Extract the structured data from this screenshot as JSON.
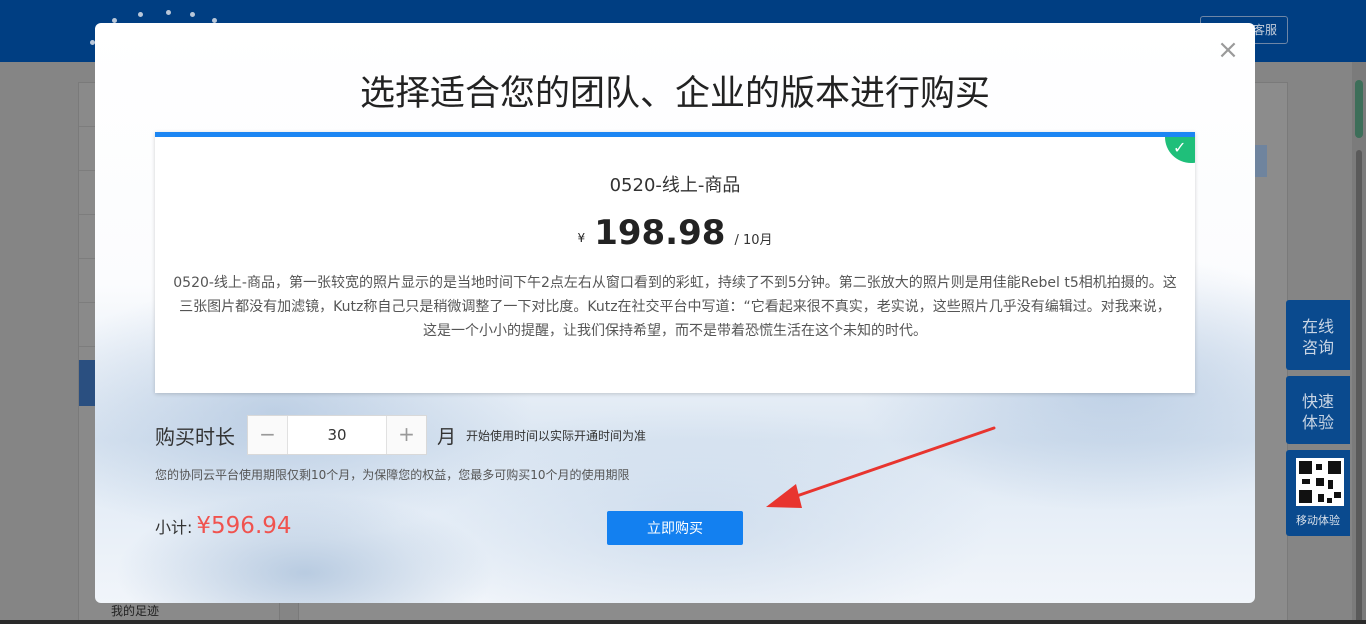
{
  "background": {
    "online_service_label": "客服",
    "sidebar_footprint": "我的足迹"
  },
  "float_buttons": {
    "consult": "在线\n咨询",
    "consult_line1": "在线",
    "consult_line2": "咨询",
    "trial_line1": "快速",
    "trial_line2": "体验",
    "mobile_label": "移动体验"
  },
  "modal": {
    "title": "选择适合您的团队、企业的版本进行购买",
    "close_icon": "close-icon",
    "plan": {
      "name": "0520-线上-商品",
      "currency": "¥",
      "price": "198.98",
      "period": "/ 10月",
      "description": "0520-线上-商品，第一张较宽的照片显示的是当地时间下午2点左右从窗口看到的彩虹，持续了不到5分钟。第二张放大的照片则是用佳能Rebel t5相机拍摄的。这三张图片都没有加滤镜，Kutz称自己只是稍微调整了一下对比度。Kutz在社交平台中写道：“它看起来很不真实，老实说，这些照片几乎没有编辑过。对我来说，这是一个小小的提醒，让我们保持希望，而不是带着恐慌生活在这个未知的时代。"
    },
    "duration": {
      "label": "购买时长",
      "minus": "−",
      "value": "30",
      "plus": "+",
      "unit": "月",
      "start_note": "开始使用时间以实际开通时间为准",
      "limit_note": "您的协同云平台使用期限仅剩10个月，为保障您的权益，您最多可购买10个月的使用期限"
    },
    "subtotal": {
      "label": "小计:",
      "value": "¥596.94"
    },
    "buy_button": "立即购买"
  },
  "colors": {
    "brand_blue": "#1380f0",
    "price_red": "#f0534f",
    "selected_green": "#1fbf7a",
    "annotation_arrow": "#e8352f"
  }
}
